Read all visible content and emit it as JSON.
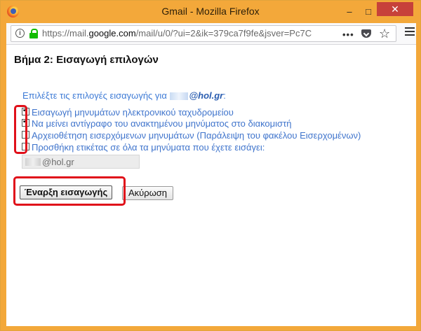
{
  "window": {
    "title": "Gmail - Mozilla Firefox",
    "minimize": "–",
    "maximize": "□",
    "close": "✕"
  },
  "urlbar": {
    "url_prefix": "https://mail.",
    "url_domain": "google.com",
    "url_rest": "/mail/u/0/?ui=2&ik=379ca7f9fe&jsver=Pc7C",
    "more_glyph": "•••",
    "star_glyph": "☆",
    "info_glyph": "i"
  },
  "page": {
    "step_title": "Βήμα 2: Εισαγωγή επιλογών",
    "intro_text": "Επιλέξτε τις επιλογές εισαγωγής για ",
    "intro_domain": "@hol.gr",
    "intro_end": ":",
    "options": [
      {
        "label": "Εισαγωγή μηνυμάτων ηλεκτρονικού ταχυδρομείου",
        "checked": true
      },
      {
        "label": "Να μείνει αντίγραφο του ανακτημένου μηνύματος στο διακομιστή",
        "checked": true
      },
      {
        "label": "Αρχειοθέτηση εισερχόμενων μηνυμάτων (Παράλειψη του φακέλου Εισερχομένων)",
        "checked": false
      },
      {
        "label": "Προσθήκη ετικέτας σε όλα τα μηνύματα που έχετε εισάγει:",
        "checked": false
      }
    ],
    "label_field_value": "@hol.gr",
    "start_button": "Έναρξη εισαγωγής",
    "cancel_button": "Ακύρωση"
  },
  "colors": {
    "window_frame": "#f3a83a",
    "close_button": "#c7413a",
    "link_blue": "#3e7bd6",
    "highlight_red": "#e0101a"
  }
}
